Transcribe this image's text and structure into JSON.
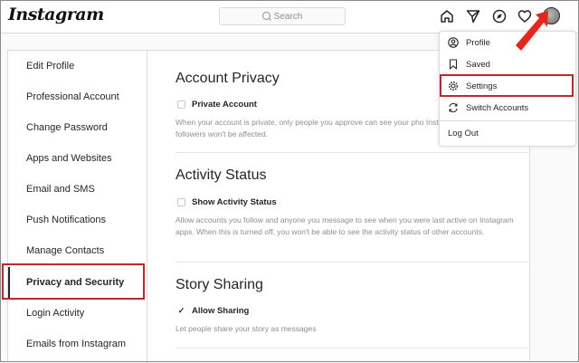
{
  "header": {
    "logo": "Instagram",
    "search_placeholder": "Search",
    "icons": [
      "home-icon",
      "direct-message-icon",
      "explore-compass-icon",
      "activity-heart-icon",
      "profile-avatar"
    ]
  },
  "sidebar": {
    "items": [
      {
        "label": "Edit Profile"
      },
      {
        "label": "Professional Account"
      },
      {
        "label": "Change Password"
      },
      {
        "label": "Apps and Websites"
      },
      {
        "label": "Email and SMS"
      },
      {
        "label": "Push Notifications"
      },
      {
        "label": "Manage Contacts"
      },
      {
        "label": "Privacy and Security",
        "active": true
      },
      {
        "label": "Login Activity"
      },
      {
        "label": "Emails from Instagram"
      }
    ]
  },
  "main": {
    "sections": [
      {
        "title": "Account Privacy",
        "checkbox_label": "Private Account",
        "checked": false,
        "description": "When your account is private, only people you approve can see your pho Instagram. Your existing followers won't be affected."
      },
      {
        "title": "Activity Status",
        "checkbox_label": "Show Activity Status",
        "checked": false,
        "description": "Allow accounts you follow and anyone you message to see when you were last active on Instagram apps. When this is turned off, you won't be able to see the activity status of other accounts."
      },
      {
        "title": "Story Sharing",
        "checkbox_label": "Allow Sharing",
        "checked": true,
        "description": "Let people share your story as messages"
      }
    ]
  },
  "dropdown": {
    "items": [
      {
        "label": "Profile",
        "icon": "profile-circle-icon"
      },
      {
        "label": "Saved",
        "icon": "bookmark-icon"
      },
      {
        "label": "Settings",
        "icon": "gear-icon",
        "highlighted": true
      },
      {
        "label": "Switch Accounts",
        "icon": "switch-arrows-icon"
      }
    ],
    "logout_label": "Log Out"
  },
  "colors": {
    "highlight_border": "#c0282f",
    "arrow": "#e8251b",
    "text": "#262626",
    "muted_text": "#8e8e8e",
    "border": "#dbdbdb"
  }
}
